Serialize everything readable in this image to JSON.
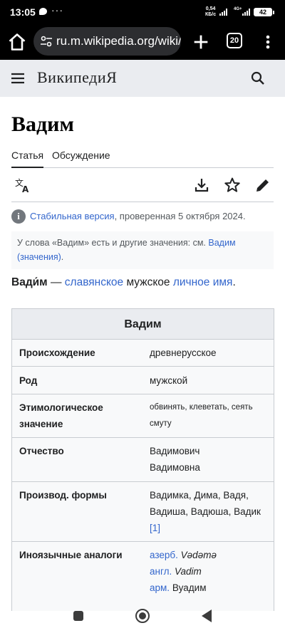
{
  "status_bar": {
    "time": "13:05",
    "dots": "···",
    "speed_value": "0,54",
    "speed_unit": "КБ/с",
    "network": "4G+",
    "battery": "42"
  },
  "browser": {
    "url": "ru.m.wikipedia.org/wiki/Вадим",
    "tab_count": "20"
  },
  "wiki": {
    "wordmark": "ВикипедиЯ"
  },
  "page": {
    "title": "Вадим",
    "tabs": {
      "article": "Статья",
      "talk": "Обсуждение"
    },
    "stable_link": "Стабильная версия",
    "stable_rest": ", проверенная 5 октября 2024.",
    "hatnote_prefix": "У слова «Вадим» есть и другие значения: см. ",
    "hatnote_link": "Вадим (значения)",
    "hatnote_suffix": ".",
    "lead": {
      "term": "Вади́м",
      "dash": " — ",
      "link1": "славянское",
      "mid": " мужское ",
      "link2": "личное имя",
      "end": "."
    }
  },
  "infobox": {
    "title": "Вадим",
    "rows": [
      {
        "key": "Происхождение",
        "value": "древнерусское"
      },
      {
        "key": "Род",
        "value": "мужской"
      },
      {
        "key1": "Этимологическое",
        "key2": "значение",
        "value1": "обвинять, клеветать, сеять",
        "value2": "смуту"
      },
      {
        "key": "Отчество",
        "value1": "Вадимович",
        "value2": "Вадимовна"
      },
      {
        "key": "Производ. формы",
        "value1": "Вадимка, Дима, Вадя,",
        "value2": "Вадиша, Вадюша, Вадик",
        "ref": "[1]"
      },
      {
        "key": "Иноязычные аналоги",
        "lines": [
          {
            "lang": "азерб.",
            "word": "Vədəmə"
          },
          {
            "lang": "англ.",
            "word": "Vadim"
          },
          {
            "lang": "арм.",
            "word": "Вуадим"
          }
        ]
      }
    ]
  },
  "colors": {
    "link": "#3366cc",
    "header_bg": "#eaecf0",
    "infobox_bg": "#f8f9fa"
  }
}
